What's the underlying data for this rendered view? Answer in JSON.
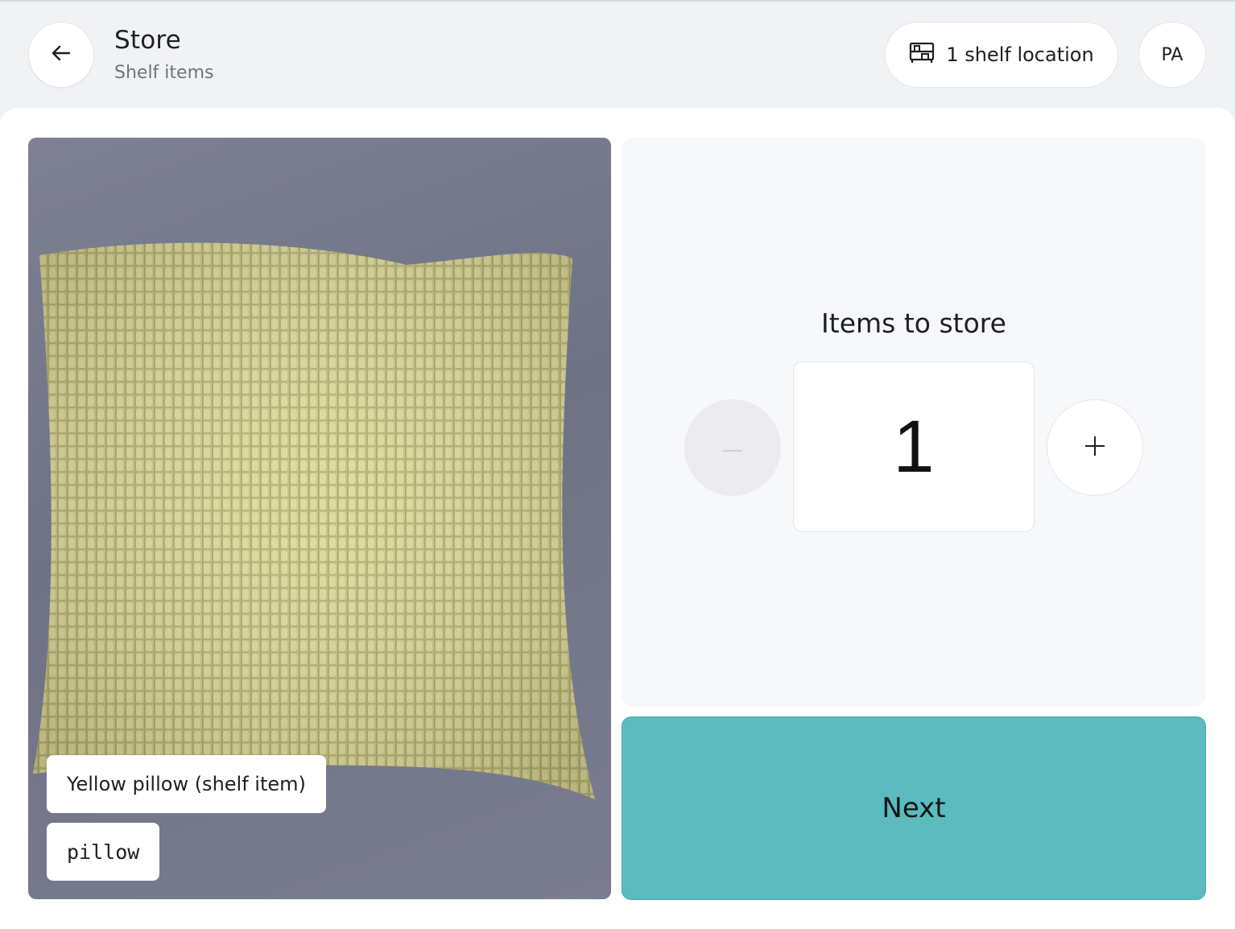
{
  "header": {
    "title": "Store",
    "subtitle": "Shelf items",
    "shelf_location_label": "1 shelf location",
    "avatar_initials": "PA"
  },
  "item": {
    "label": "Yellow pillow (shelf item)",
    "type": "pillow"
  },
  "quantity": {
    "title": "Items to store",
    "value": "1"
  },
  "actions": {
    "next_label": "Next"
  },
  "colors": {
    "accent": "#5bbbbe",
    "background": "#f1f2f4"
  }
}
